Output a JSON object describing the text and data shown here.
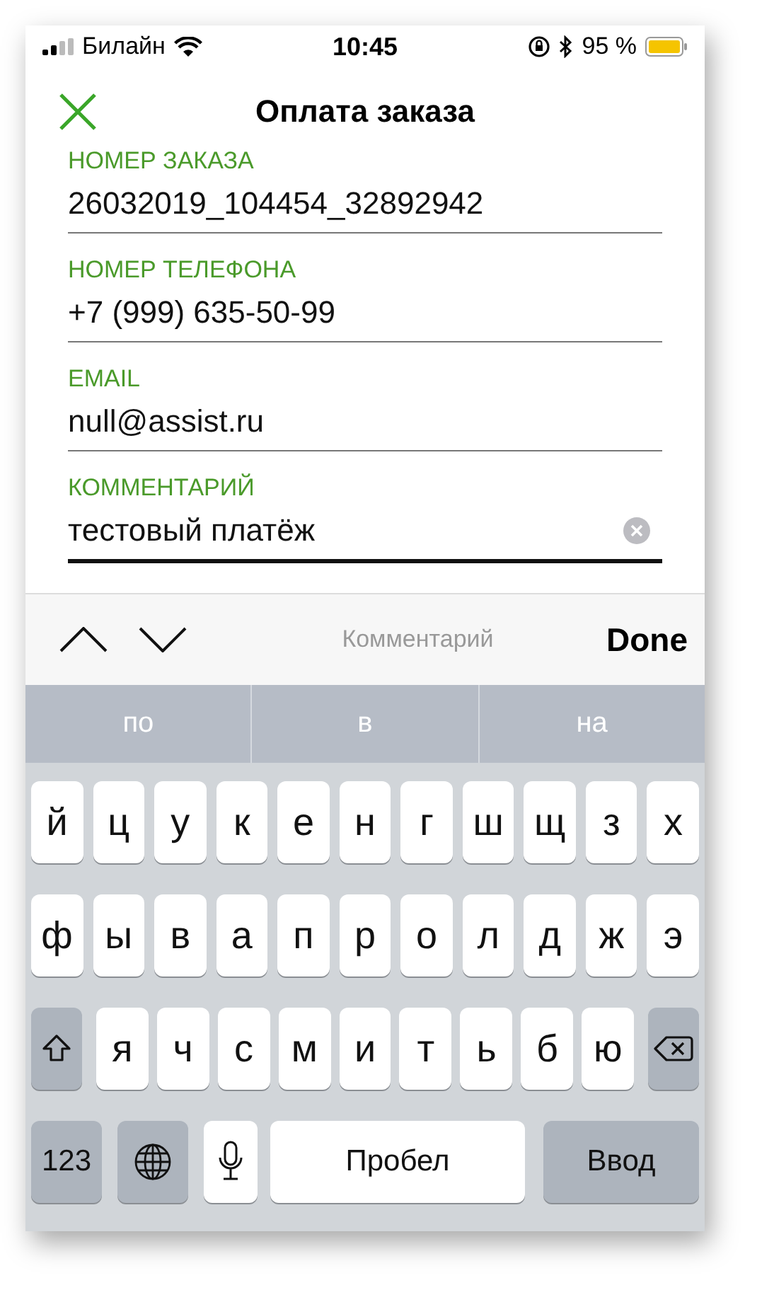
{
  "status_bar": {
    "carrier": "Билайн",
    "time": "10:45",
    "battery": "95 %"
  },
  "nav": {
    "title": "Оплата заказа"
  },
  "fields": [
    {
      "label": "НОМЕР ЗАКАЗА",
      "value": "26032019_104454_32892942",
      "focused": false
    },
    {
      "label": "НОМЕР ТЕЛЕФОНА",
      "value": "+7 (999) 635-50-99",
      "focused": false
    },
    {
      "label": "EMAIL",
      "value": "null@assist.ru",
      "focused": false
    },
    {
      "label": "КОММЕНТАРИЙ",
      "value": "тестовый платёж",
      "focused": true
    }
  ],
  "toolbar": {
    "field_name": "Комментарий",
    "done": "Done"
  },
  "suggestions": [
    "по",
    "в",
    "на"
  ],
  "keyboard": [
    [
      {
        "kind": "letter",
        "label": "й"
      },
      {
        "kind": "letter",
        "label": "ц"
      },
      {
        "kind": "letter",
        "label": "у"
      },
      {
        "kind": "letter",
        "label": "к"
      },
      {
        "kind": "letter",
        "label": "е"
      },
      {
        "kind": "letter",
        "label": "н"
      },
      {
        "kind": "letter",
        "label": "г"
      },
      {
        "kind": "letter",
        "label": "ш"
      },
      {
        "kind": "letter",
        "label": "щ"
      },
      {
        "kind": "letter",
        "label": "з"
      },
      {
        "kind": "letter",
        "label": "х"
      }
    ],
    [
      {
        "kind": "letter",
        "label": "ф"
      },
      {
        "kind": "letter",
        "label": "ы"
      },
      {
        "kind": "letter",
        "label": "в"
      },
      {
        "kind": "letter",
        "label": "а"
      },
      {
        "kind": "letter",
        "label": "п"
      },
      {
        "kind": "letter",
        "label": "р"
      },
      {
        "kind": "letter",
        "label": "о"
      },
      {
        "kind": "letter",
        "label": "л"
      },
      {
        "kind": "letter",
        "label": "д"
      },
      {
        "kind": "letter",
        "label": "ж"
      },
      {
        "kind": "letter",
        "label": "э"
      }
    ],
    [
      {
        "kind": "shift"
      },
      {
        "kind": "letter",
        "label": "я"
      },
      {
        "kind": "letter",
        "label": "ч"
      },
      {
        "kind": "letter",
        "label": "с"
      },
      {
        "kind": "letter",
        "label": "м"
      },
      {
        "kind": "letter",
        "label": "и"
      },
      {
        "kind": "letter",
        "label": "т"
      },
      {
        "kind": "letter",
        "label": "ь"
      },
      {
        "kind": "letter",
        "label": "б"
      },
      {
        "kind": "letter",
        "label": "ю"
      },
      {
        "kind": "backspace"
      }
    ],
    [
      {
        "kind": "numbers",
        "label": "123"
      },
      {
        "kind": "globe"
      },
      {
        "kind": "mic"
      },
      {
        "kind": "space",
        "label": "Пробел"
      },
      {
        "kind": "return",
        "label": "Ввод"
      }
    ]
  ]
}
